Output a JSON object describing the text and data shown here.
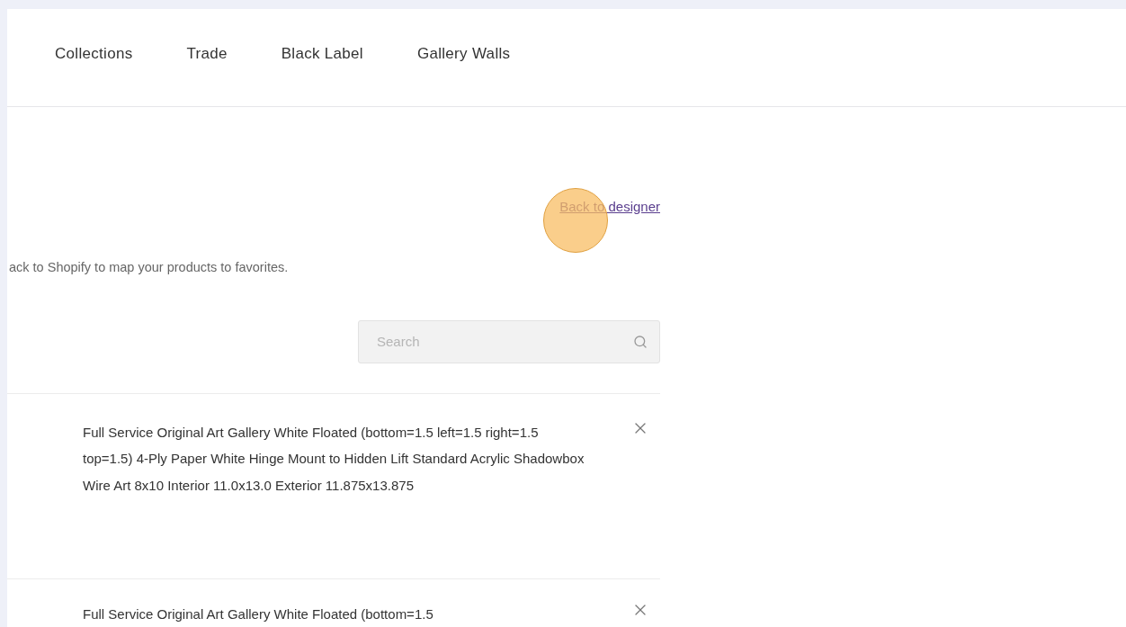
{
  "nav": {
    "items": [
      "Collections",
      "Trade",
      "Black Label",
      "Gallery Walls"
    ]
  },
  "back_link": "Back to designer",
  "description": "ack to Shopify to map your products to favorites.",
  "search": {
    "placeholder": "Search"
  },
  "products": [
    {
      "name": "Full Service Original Art Gallery White Floated (bottom=1.5 left=1.5 right=1.5 top=1.5) 4-Ply Paper White Hinge Mount to Hidden Lift Standard Acrylic Shadowbox Wire Art 8x10 Interior 11.0x13.0 Exterior 11.875x13.875"
    },
    {
      "name": "Full Service Original Art Gallery White Floated (bottom=1.5"
    }
  ]
}
